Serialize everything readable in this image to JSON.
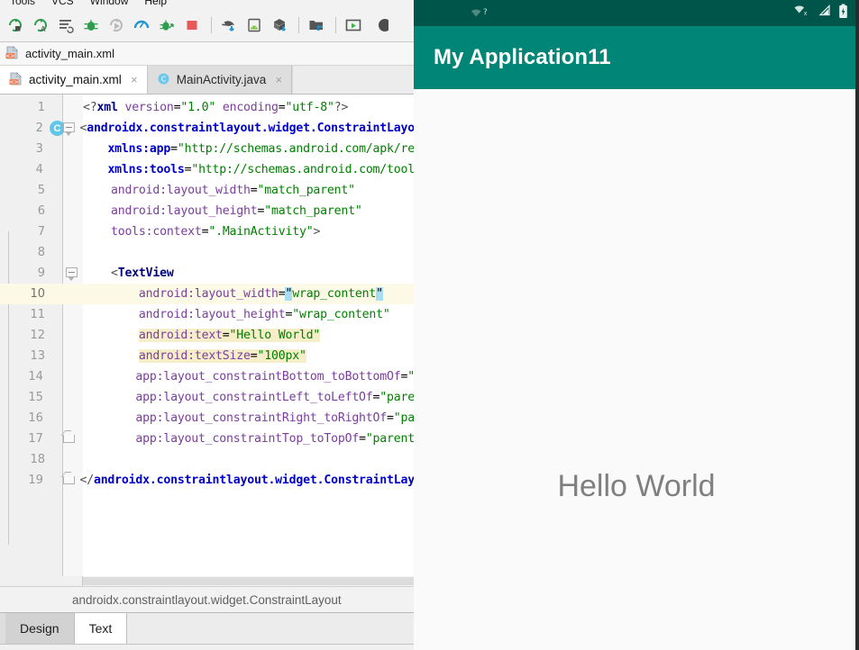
{
  "menu": {
    "items": [
      {
        "label": "Tools"
      },
      {
        "label": "VCS"
      },
      {
        "label": "Window"
      },
      {
        "label": "Help"
      }
    ]
  },
  "toolbar": {
    "buttons": [
      {
        "name": "run-icon",
        "title": "Run"
      },
      {
        "name": "run-with-coverage-icon",
        "title": "Run with Coverage"
      },
      {
        "name": "edit-configurations-icon",
        "title": "Edit Configurations"
      },
      {
        "name": "debug-icon",
        "title": "Debug"
      },
      {
        "name": "attach-debugger-icon",
        "title": "Attach Debugger"
      },
      {
        "name": "profiler-icon",
        "title": "Profiler"
      },
      {
        "name": "apply-changes-icon",
        "title": "Apply Changes"
      },
      {
        "name": "stop-icon",
        "title": "Stop"
      },
      {
        "name": "sync-gradle-icon",
        "title": "Sync Project with Gradle Files"
      },
      {
        "name": "avd-manager-icon",
        "title": "AVD Manager"
      },
      {
        "name": "sdk-manager-icon",
        "title": "SDK Manager"
      },
      {
        "name": "project-structure-icon",
        "title": "Project Structure"
      },
      {
        "name": "layout-inspector-icon",
        "title": "Layout Inspector"
      }
    ]
  },
  "filestrip": {
    "icon": "xml-file-icon",
    "label": "activity_main.xml"
  },
  "editor_tabs": [
    {
      "label": "activity_main.xml",
      "icon": "xml-file-icon",
      "active": true,
      "close": "×"
    },
    {
      "label": "MainActivity.java",
      "icon": "java-class-icon",
      "active": false,
      "close": "×"
    }
  ],
  "code": {
    "current_line": 10,
    "lines": [
      {
        "n": "1",
        "text": "<?xml version=\"1.0\" encoding=\"utf-8\"?>"
      },
      {
        "n": "2",
        "text": "<androidx.constraintlayout.widget.ConstraintLayo"
      },
      {
        "n": "3",
        "text": "    xmlns:app=\"http://schemas.android.com/apk/re"
      },
      {
        "n": "4",
        "text": "    xmlns:tools=\"http://schemas.android.com/tool"
      },
      {
        "n": "5",
        "text": "    android:layout_width=\"match_parent\""
      },
      {
        "n": "6",
        "text": "    android:layout_height=\"match_parent\""
      },
      {
        "n": "7",
        "text": "    tools:context=\".MainActivity\">"
      },
      {
        "n": "8",
        "text": ""
      },
      {
        "n": "9",
        "text": "    <TextView"
      },
      {
        "n": "10",
        "text": "        android:layout_width=\"wrap_content\""
      },
      {
        "n": "11",
        "text": "        android:layout_height=\"wrap_content\""
      },
      {
        "n": "12",
        "text": "        android:text=\"Hello World\""
      },
      {
        "n": "13",
        "text": "        android:textSize=\"100px\""
      },
      {
        "n": "14",
        "text": "        app:layout_constraintBottom_toBottomOf=\""
      },
      {
        "n": "15",
        "text": "        app:layout_constraintLeft_toLeftOf=\"pare"
      },
      {
        "n": "16",
        "text": "        app:layout_constraintRight_toRightOf=\"pa"
      },
      {
        "n": "17",
        "text": "        app:layout_constraintTop_toTopOf=\"parent"
      },
      {
        "n": "18",
        "text": ""
      },
      {
        "n": "19",
        "text": "</androidx.constraintlayout.widget.ConstraintLay"
      }
    ],
    "gutter_marker_line2": "C"
  },
  "bottom_breadcrumb": {
    "label": "androidx.constraintlayout.widget.ConstraintLayout"
  },
  "design_tabs": [
    {
      "label": "Design",
      "active": false
    },
    {
      "label": "Text",
      "active": true
    }
  ],
  "emulator": {
    "status_bar": {
      "wifi_question_icon": "wifi-question-icon",
      "wifi_off_icon": "wifi-no-connection-icon",
      "signal_icon": "cell-signal-icon",
      "battery_icon": "battery-icon",
      "bg_color": "#00554a"
    },
    "app_bar": {
      "title": "My Application11",
      "bg_color": "#008577",
      "text_color": "#ffffff"
    },
    "content": {
      "hello_text": "Hello World",
      "hello_color": "#7f7f7f",
      "bg_color": "#fafafa"
    }
  },
  "colors": {
    "accent_teal": "#008577",
    "accent_teal_dark": "#00554a",
    "highlight_line": "#f5eec8",
    "selection": "#a8dcf0",
    "current_line": "#fcf9e6"
  }
}
